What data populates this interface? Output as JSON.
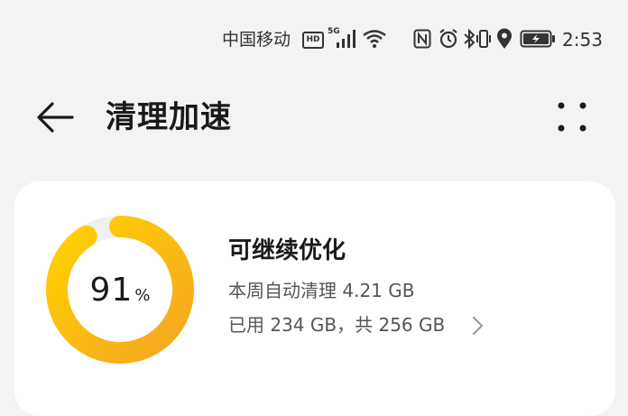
{
  "status_bar": {
    "carrier": "中国移动",
    "hd_badge": "HD",
    "network_type": "5G",
    "time": "2:53",
    "icons": [
      "hd-icon",
      "signal-icon",
      "wifi-icon",
      "nfc-icon",
      "alarm-icon",
      "bluetooth-icon",
      "vibrate-icon",
      "location-icon",
      "battery-charging-icon"
    ]
  },
  "header": {
    "title": "清理加速",
    "back_icon": "back-arrow-icon",
    "more_icon": "more-dots-icon"
  },
  "storage": {
    "percent": "91",
    "percent_unit": "%",
    "title": "可继续优化",
    "auto_clean": "本周自动清理 4.21 GB",
    "usage": "已用 234 GB，共 256 GB",
    "used_fraction": 0.91
  },
  "colors": {
    "ring_start": "#f5a623",
    "ring_end": "#ffd200",
    "background": "#f1f3f5",
    "card": "#ffffff"
  }
}
